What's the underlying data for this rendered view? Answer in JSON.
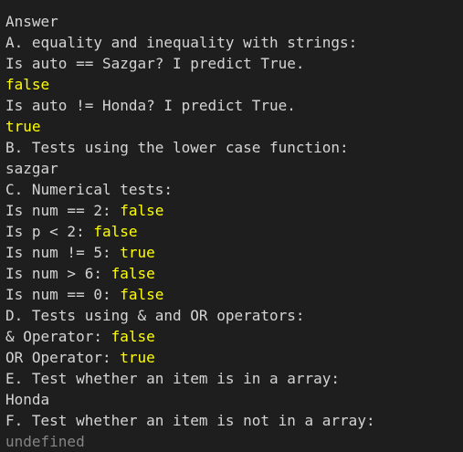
{
  "console": {
    "lines": [
      {
        "text": "Answer",
        "value": ""
      },
      {
        "text": "A. equality and inequality with strings:",
        "value": ""
      },
      {
        "text": "Is auto == Sazgar? I predict True.",
        "value": ""
      },
      {
        "text": "",
        "value": "false"
      },
      {
        "text": "Is auto != Honda? I predict True.",
        "value": ""
      },
      {
        "text": "",
        "value": "true"
      },
      {
        "text": "B. Tests using the lower case function:",
        "value": ""
      },
      {
        "text": "sazgar",
        "value": ""
      },
      {
        "text": "C. Numerical tests:",
        "value": ""
      },
      {
        "text": "Is num == 2: ",
        "value": "false"
      },
      {
        "text": "Is p < 2: ",
        "value": "false"
      },
      {
        "text": "Is num != 5: ",
        "value": "true"
      },
      {
        "text": "Is num > 6: ",
        "value": "false"
      },
      {
        "text": "Is num == 0: ",
        "value": "false"
      },
      {
        "text": "D. Tests using & and OR operators:",
        "value": ""
      },
      {
        "text": "& Operator: ",
        "value": "false"
      },
      {
        "text": "OR Operator: ",
        "value": "true"
      },
      {
        "text": "E. Test whether an item is in a array:",
        "value": ""
      },
      {
        "text": "Honda",
        "value": ""
      },
      {
        "text": "F. Test whether an item is not in a array:",
        "value": ""
      },
      {
        "text": "",
        "value": "undefined",
        "muted": true
      }
    ]
  },
  "colors": {
    "background": "#1e1e1e",
    "text": "#d4d4d4",
    "boolean": "#ffff00",
    "undefined": "#858585"
  }
}
